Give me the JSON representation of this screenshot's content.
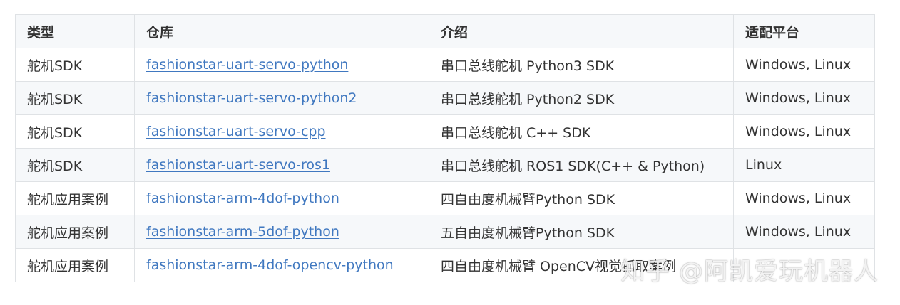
{
  "table": {
    "headers": [
      "类型",
      "仓库",
      "介绍",
      "适配平台"
    ],
    "rows": [
      {
        "type": "舵机SDK",
        "repo": "fashionstar-uart-servo-python",
        "intro": "串口总线舵机 Python3 SDK",
        "platform": "Windows, Linux"
      },
      {
        "type": "舵机SDK",
        "repo": "fashionstar-uart-servo-python2",
        "intro": "串口总线舵机 Python2 SDK",
        "platform": "Windows, Linux"
      },
      {
        "type": "舵机SDK",
        "repo": "fashionstar-uart-servo-cpp",
        "intro": "串口总线舵机 C++ SDK",
        "platform": "Windows, Linux"
      },
      {
        "type": "舵机SDK",
        "repo": "fashionstar-uart-servo-ros1",
        "intro": "串口总线舵机 ROS1 SDK(C++ & Python)",
        "platform": "Linux"
      },
      {
        "type": "舵机应用案例",
        "repo": "fashionstar-arm-4dof-python",
        "intro": "四自由度机械臂Python SDK",
        "platform": "Windows, Linux"
      },
      {
        "type": "舵机应用案例",
        "repo": "fashionstar-arm-5dof-python",
        "intro": "五自由度机械臂Python SDK",
        "platform": "Windows, Linux"
      },
      {
        "type": "舵机应用案例",
        "repo": "fashionstar-arm-4dof-opencv-python",
        "intro": "四自由度机械臂 OpenCV视觉抓取案例",
        "platform": ""
      }
    ]
  },
  "watermark": "知乎 @阿凯爱玩机器人",
  "colors": {
    "link": "#4078c0",
    "header_bg": "#f6f8fa",
    "border": "#dfe2e5",
    "text": "#333333"
  }
}
